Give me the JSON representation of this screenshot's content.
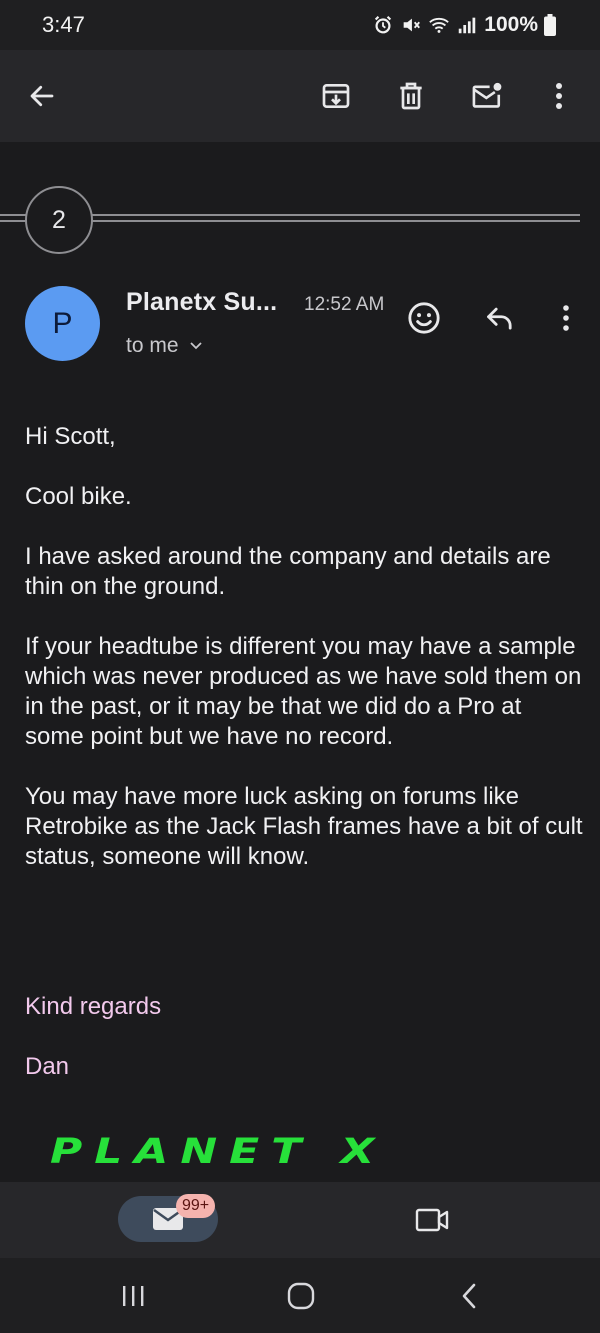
{
  "status_bar": {
    "time": "3:47",
    "battery": "100%",
    "icons": [
      "alarm-icon",
      "mute-icon",
      "wifi-icon",
      "signal-icon",
      "battery-icon"
    ]
  },
  "app_bar": {
    "icons": [
      "back-arrow-icon",
      "archive-icon",
      "delete-icon",
      "mark-unread-icon",
      "more-vert-icon"
    ]
  },
  "thread": {
    "collapsed_count": "2"
  },
  "message": {
    "avatar_letter": "P",
    "avatar_color": "#5b9bf2",
    "sender": "Planetx Su...",
    "time": "12:52 AM",
    "recipient": "to me",
    "header_icons": [
      "emoji-reaction-icon",
      "reply-icon",
      "more-vert-icon"
    ],
    "body": [
      "Hi Scott,",
      "Cool bike.",
      "I have asked around the company and details are thin on the ground.",
      "If your headtube is different you may have a sample which was never produced as we have sold them on in the past, or it may be that we did do a Pro at some point but we have no record.",
      "You may have more luck asking on forums like Retrobike as the Jack Flash frames have a bit of cult status, someone will know."
    ],
    "signoff": "Kind regards",
    "signature": "Dan",
    "signature_color": "#f2c9ec",
    "logo_text": "PLANET X",
    "logo_color": "#27e03a"
  },
  "bottom_nav": {
    "mail_badge": "99+",
    "icons": [
      "mail-icon",
      "video-call-icon"
    ]
  },
  "system_nav": {
    "icons": [
      "recent-apps-icon",
      "home-icon",
      "back-icon"
    ]
  }
}
